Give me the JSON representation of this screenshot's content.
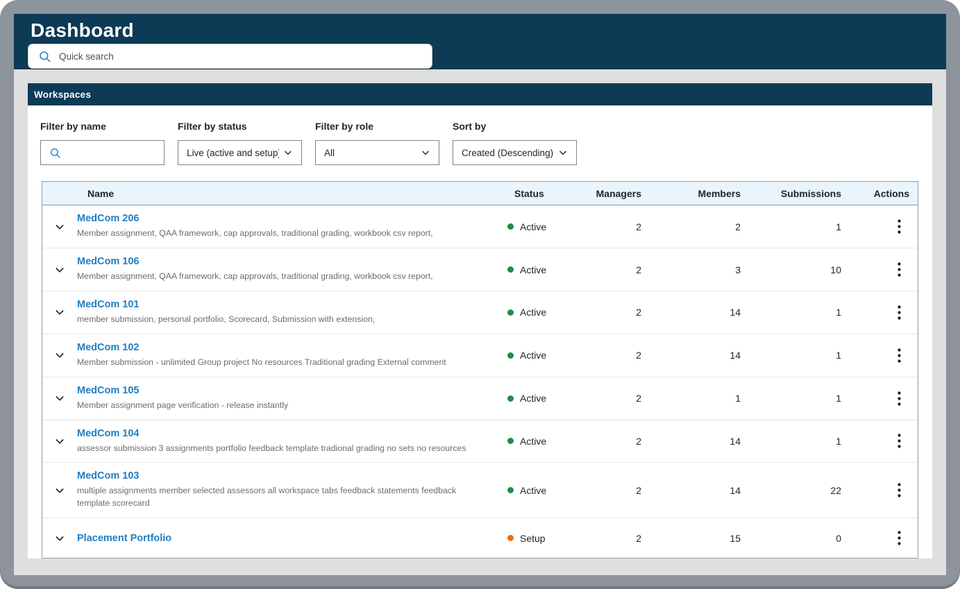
{
  "header": {
    "title": "Dashboard",
    "search_placeholder": "Quick search"
  },
  "panel": {
    "title": "Workspaces",
    "filters": {
      "name": {
        "label": "Filter by name",
        "value": ""
      },
      "status": {
        "label": "Filter by status",
        "value": "Live (active and setup)"
      },
      "role": {
        "label": "Filter by role",
        "value": "All"
      },
      "sort": {
        "label": "Sort by",
        "value": "Created (Descending)"
      }
    },
    "table": {
      "columns": [
        "Name",
        "Status",
        "Managers",
        "Members",
        "Submissions",
        "Actions"
      ],
      "rows": [
        {
          "name": "MedCom 206",
          "description": "Member assignment, QAA framework, cap approvals, traditional grading, workbook csv report,",
          "status": "Active",
          "managers": 2,
          "members": 2,
          "submissions": 1
        },
        {
          "name": "MedCom 106",
          "description": "Member assignment, QAA framework, cap approvals, traditional grading, workbook csv report,",
          "status": "Active",
          "managers": 2,
          "members": 3,
          "submissions": 10
        },
        {
          "name": "MedCom 101",
          "description": "member submission, personal portfolio, Scorecard, Submission with extension,",
          "status": "Active",
          "managers": 2,
          "members": 14,
          "submissions": 1
        },
        {
          "name": "MedCom 102",
          "description": "Member submission - unlimited Group project No resources Traditional grading External comment",
          "status": "Active",
          "managers": 2,
          "members": 14,
          "submissions": 1
        },
        {
          "name": "MedCom 105",
          "description": "Member assignment page verification - release instantly",
          "status": "Active",
          "managers": 2,
          "members": 1,
          "submissions": 1
        },
        {
          "name": "MedCom 104",
          "description": "assessor submission 3 assignments portfolio feedback template tradional grading no sets no resources",
          "status": "Active",
          "managers": 2,
          "members": 14,
          "submissions": 1
        },
        {
          "name": "MedCom 103",
          "description": "multiple assignments member selected assessors all workspace tabs feedback statements feedback template scorecard",
          "status": "Active",
          "managers": 2,
          "members": 14,
          "submissions": 22
        },
        {
          "name": "Placement Portfolio",
          "description": "",
          "status": "Setup",
          "managers": 2,
          "members": 15,
          "submissions": 0
        }
      ]
    }
  },
  "colors": {
    "navy": "#0d3a55",
    "link_blue": "#1f7fc4",
    "search_icon_blue": "#2b7cc9",
    "table_header_bg": "#e9f4fc",
    "status": {
      "Active": "#218a47",
      "Setup": "#ea6d10"
    }
  }
}
